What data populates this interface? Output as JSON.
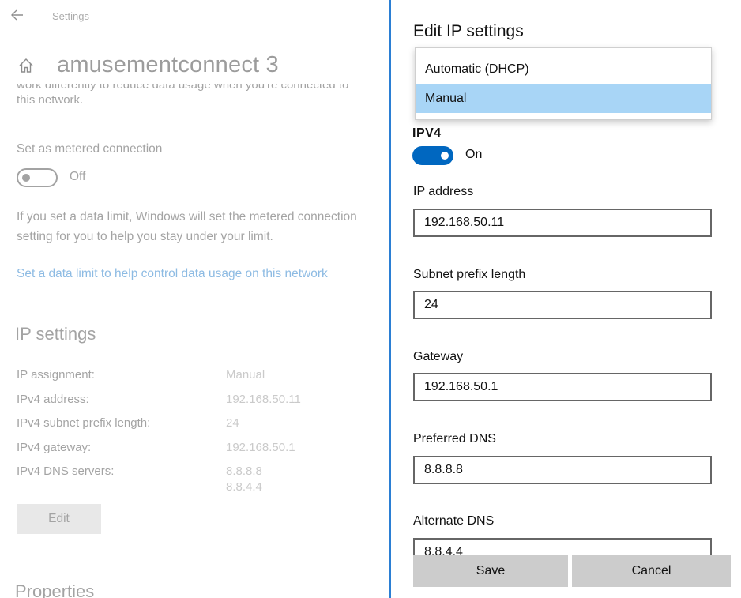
{
  "settings_page": {
    "app_title": "Settings",
    "network_name": "amusementconnect 3",
    "metered_description_line1": "work differently to reduce data usage when you're connected to",
    "metered_description_line2": "this network.",
    "metered_label": "Set as metered connection",
    "metered_toggle_state": "Off",
    "data_limit_text_line1": "If you set a data limit, Windows will set the metered connection",
    "data_limit_text_line2": "setting for you to help you stay under your limit.",
    "data_limit_link": "Set a data limit to help control data usage on this network",
    "ip_settings_heading": "IP settings",
    "ip_rows": [
      {
        "key": "IP assignment:",
        "value": "Manual"
      },
      {
        "key": "IPv4 address:",
        "value": "192.168.50.11"
      },
      {
        "key": "IPv4 subnet prefix length:",
        "value": "24"
      },
      {
        "key": "IPv4 gateway:",
        "value": "192.168.50.1"
      },
      {
        "key": "IPv4 DNS servers:",
        "value": "8.8.8.8",
        "value2": "8.8.4.4"
      }
    ],
    "edit_button": "Edit",
    "properties_heading": "Properties"
  },
  "dialog": {
    "title": "Edit IP settings",
    "dropdown_options": [
      {
        "label": "Automatic (DHCP)",
        "selected": false
      },
      {
        "label": "Manual",
        "selected": true
      }
    ],
    "ipv4_heading": "IPV4",
    "ipv4_toggle_state": "On",
    "fields": {
      "ip_address": {
        "label": "IP address",
        "value": "192.168.50.11"
      },
      "subnet_prefix_length": {
        "label": "Subnet prefix length",
        "value": "24"
      },
      "gateway": {
        "label": "Gateway",
        "value": "192.168.50.1"
      },
      "preferred_dns": {
        "label": "Preferred DNS",
        "value": "8.8.8.8"
      },
      "alternate_dns": {
        "label": "Alternate DNS",
        "value": "8.8.4.4"
      }
    },
    "save_button": "Save",
    "cancel_button": "Cancel"
  },
  "colors": {
    "accent": "#0067c0",
    "dropdown_selected": "#a8d5f6",
    "button_gray": "#cccccc"
  }
}
